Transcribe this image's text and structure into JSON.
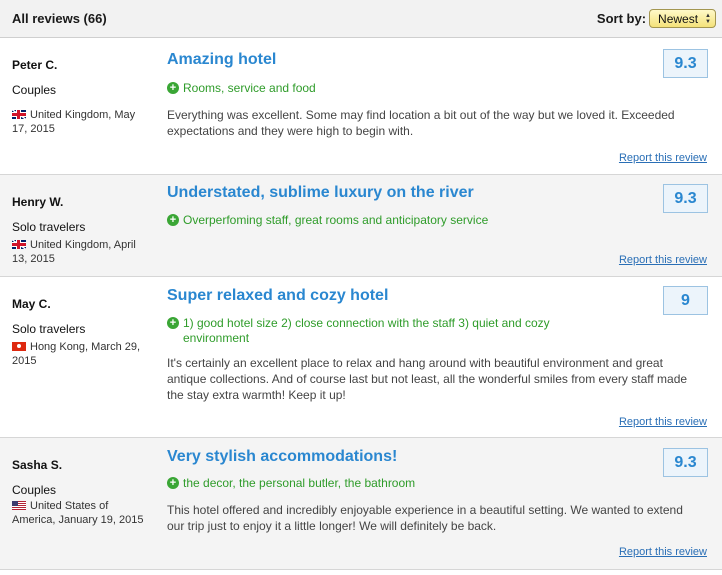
{
  "header": {
    "title": "All reviews (66)",
    "sort_label": "Sort by:",
    "sort_value": "Newest"
  },
  "colors": {
    "title_blue": "#2a87d0",
    "pros_green": "#2f9c2a",
    "score_bg": "#ecf4fb"
  },
  "reviews": [
    {
      "name": "Peter C.",
      "traveler_type": "Couples",
      "flag": "uk-flag-icon",
      "origin": "United Kingdom, May 17, 2015",
      "title": "Amazing hotel",
      "pros": "Rooms, service and food",
      "text": "Everything was excellent. Some may find location a bit out of the way but we loved it. Exceeded expectations and they were high to begin with.",
      "score": "9.3",
      "report": "Report this review"
    },
    {
      "name": "Henry W.",
      "traveler_type": "Solo travelers",
      "flag": "uk-flag-icon",
      "origin": "United Kingdom, April 13, 2015",
      "title": "Understated, sublime luxury on the river",
      "pros": "Overperfoming staff, great rooms and anticipatory service",
      "text": "",
      "score": "9.3",
      "report": "Report this review"
    },
    {
      "name": "May C.",
      "traveler_type": "Solo travelers",
      "flag": "hk-flag-icon",
      "origin": "Hong Kong, March 29, 2015",
      "title": "Super relaxed and cozy hotel",
      "pros": "1) good hotel size 2) close connection with the staff 3) quiet and cozy environment",
      "text": "It's certainly an excellent place to relax and hang around with beautiful environment and great antique collections. And of course last but not least, all the wonderful smiles from every staff made the stay extra warmth! Keep it up!",
      "score": "9",
      "report": "Report this review"
    },
    {
      "name": "Sasha S.",
      "traveler_type": "Couples",
      "flag": "us-flag-icon",
      "origin": "United States of America, January 19, 2015",
      "title": "Very stylish accommodations!",
      "pros": "the decor, the personal butler, the bathroom",
      "text": "This hotel offered and incredibly enjoyable experience in a beautiful setting. We wanted to extend our trip just to enjoy it a little longer! We will definitely be back.",
      "score": "9.3",
      "report": "Report this review"
    }
  ]
}
